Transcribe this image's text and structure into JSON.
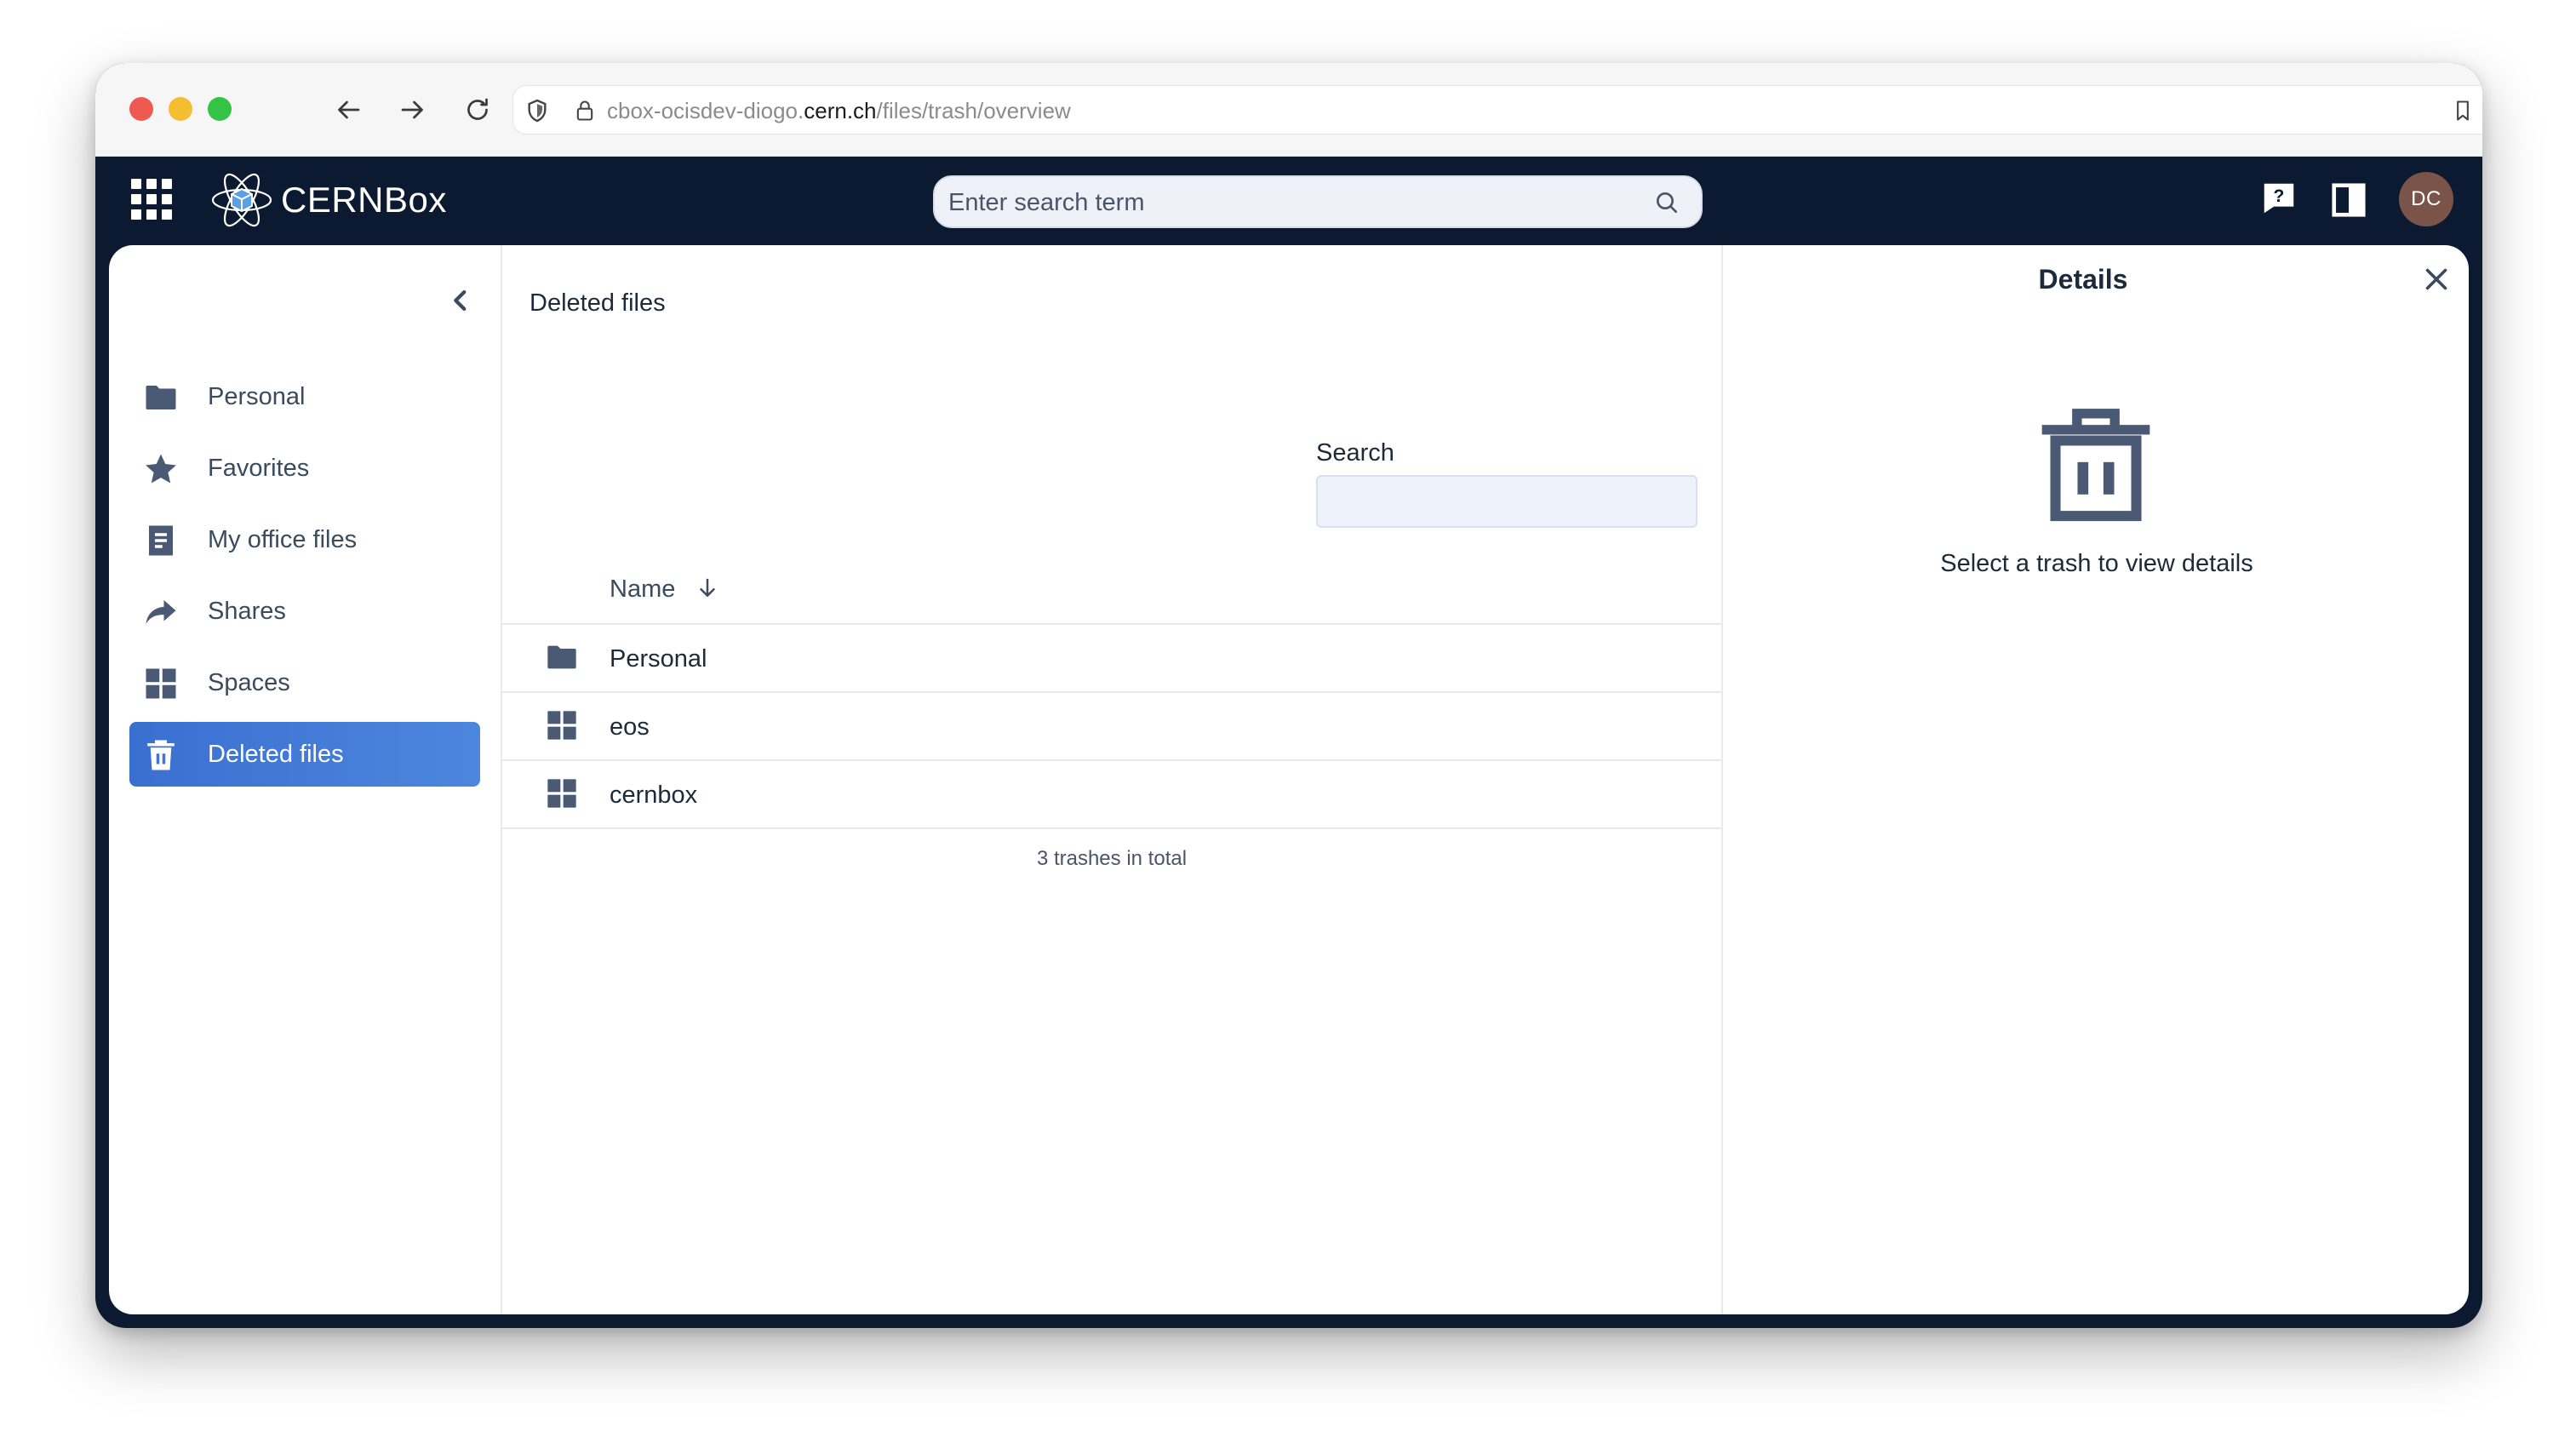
{
  "browser": {
    "url_prefix": "cbox-ocisdev-diogo.",
    "url_domain": "cern.ch",
    "url_path": "/files/trash/overview"
  },
  "app": {
    "brand": "CERNBox",
    "search_placeholder": "Enter search term",
    "avatar_initials": "DC",
    "accent_color": "#4a7fd9",
    "header_color": "#0c1a31"
  },
  "sidebar": {
    "items": [
      {
        "label": "Personal",
        "icon": "folder-icon",
        "active": false
      },
      {
        "label": "Favorites",
        "icon": "star-icon",
        "active": false
      },
      {
        "label": "My office files",
        "icon": "document-icon",
        "active": false
      },
      {
        "label": "Shares",
        "icon": "share-arrow-icon",
        "active": false
      },
      {
        "label": "Spaces",
        "icon": "grid-icon",
        "active": false
      },
      {
        "label": "Deleted files",
        "icon": "trash-icon",
        "active": true
      }
    ]
  },
  "main": {
    "breadcrumb": "Deleted files",
    "search_label": "Search",
    "column_name": "Name",
    "rows": [
      {
        "name": "Personal",
        "icon": "folder-icon"
      },
      {
        "name": "eos",
        "icon": "grid-icon"
      },
      {
        "name": "cernbox",
        "icon": "grid-icon"
      }
    ],
    "total": "3 trashes in total"
  },
  "details": {
    "title": "Details",
    "hint": "Select a trash to view details"
  }
}
